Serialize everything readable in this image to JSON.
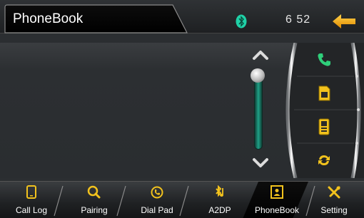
{
  "header": {
    "title": "PhoneBook",
    "clock": "6 52"
  },
  "icons": {
    "bluetooth": "bluetooth-icon",
    "back": "back-arrow-icon",
    "call": "phone-call-icon",
    "sim": "sim-card-icon",
    "phone_memory": "phone-memory-icon",
    "sync": "sync-icon",
    "scroll_up": "chevron-up-icon",
    "scroll_down": "chevron-down-icon"
  },
  "colors": {
    "accent_green": "#2fcf7a",
    "icon_yellow": "#f2c21d",
    "back_arrow": "#f5a800",
    "bluetooth": "#1fd1a7"
  },
  "tabs": [
    {
      "label": "Call Log",
      "icon": "call-log-icon",
      "active": false
    },
    {
      "label": "Pairing",
      "icon": "search-icon",
      "active": false
    },
    {
      "label": "Dial Pad",
      "icon": "dial-pad-icon",
      "active": false
    },
    {
      "label": "A2DP",
      "icon": "a2dp-icon",
      "active": false
    },
    {
      "label": "PhoneBook",
      "icon": "phonebook-icon",
      "active": true
    },
    {
      "label": "Setting",
      "icon": "setting-icon",
      "active": false
    }
  ]
}
